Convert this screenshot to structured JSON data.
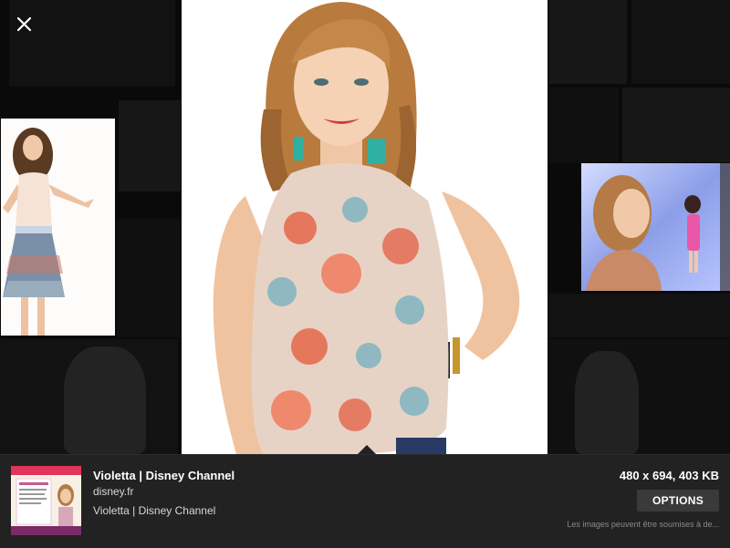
{
  "viewer": {
    "close_icon": "close-icon"
  },
  "info": {
    "title": "Violetta | Disney Channel",
    "domain": "disney.fr",
    "description": "Violetta | Disney Channel",
    "dimensions": "480 x 694, 403 KB",
    "options_label": "OPTIONS",
    "copyright": "Les images peuvent être soumises à de..."
  },
  "colors": {
    "background": "#000000",
    "info_bar": "#222222",
    "options_button": "#3a3a3a"
  }
}
